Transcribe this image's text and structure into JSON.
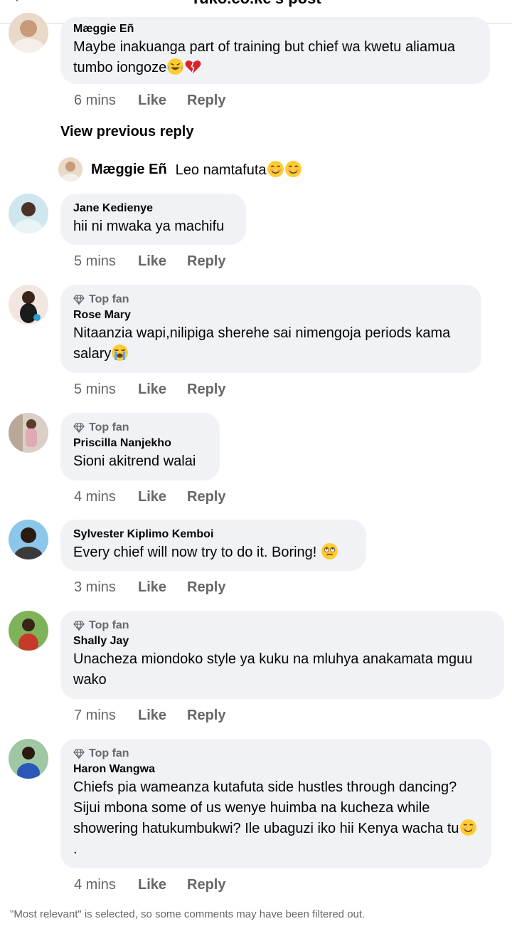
{
  "header": {
    "title": "Tuko.co.ke's post"
  },
  "top_comment": {
    "author": "Mæggie Eñ",
    "text": "Maybe inakuanga part of training but chief wa kwetu aliamua tumbo iongoze",
    "time": "6 mins"
  },
  "view_previous_reply": "View previous reply",
  "reply_preview": {
    "author": "Mæggie Eñ",
    "text": "Leo namtafuta"
  },
  "labels": {
    "like": "Like",
    "reply": "Reply",
    "top_fan": "Top fan"
  },
  "comments": [
    {
      "author": "Jane Kedienye",
      "text": "hii ni mwaka ya machifu",
      "time": "5 mins",
      "top_fan": false
    },
    {
      "author": "Rose Mary",
      "text": "Nitaanzia wapi,nilipiga sherehe sai nimengoja periods kama salary",
      "time": "5 mins",
      "top_fan": true
    },
    {
      "author": "Priscilla Nanjekho",
      "text": "Sioni akitrend  walai",
      "time": "4 mins",
      "top_fan": true
    },
    {
      "author": "Sylvester Kiplimo Kemboi",
      "text": "Every chief will now try to do it. Boring!",
      "time": "3 mins",
      "top_fan": false
    },
    {
      "author": "Shally Jay",
      "text": "Unacheza miondoko style ya kuku na mluhya anakamata mguu wako",
      "time": "7 mins",
      "top_fan": true
    },
    {
      "author": "Haron Wangwa",
      "text": "Chiefs pia wameanza kutafuta side hustles through dancing? Sijui mbona some of us wenye huimba na kucheza while showering hatukumbukwi? Ile ubaguzi iko hii Kenya wacha tu",
      "text_end": ".",
      "time": "4 mins",
      "top_fan": true
    }
  ],
  "footer_note": "\"Most relevant\" is selected, so some comments may have been filtered out."
}
